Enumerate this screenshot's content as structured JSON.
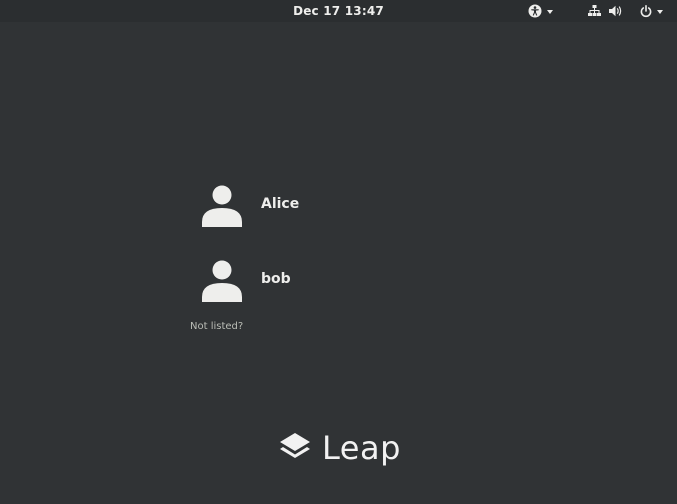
{
  "topbar": {
    "clock": "Dec 17  13:47",
    "accessibility_icon": "accessibility-icon",
    "network_icon": "network-wired-icon",
    "volume_icon": "volume-icon",
    "power_icon": "power-icon"
  },
  "users": [
    {
      "name": "Alice",
      "icon": "user-avatar-icon"
    },
    {
      "name": "bob",
      "icon": "user-avatar-icon"
    }
  ],
  "not_listed_label": "Not listed?",
  "logo": {
    "text": "Leap",
    "icon": "leap-logo-icon"
  },
  "colors": {
    "background": "#303335",
    "topbar": "#2b2e30",
    "foreground": "#eeeeec"
  }
}
